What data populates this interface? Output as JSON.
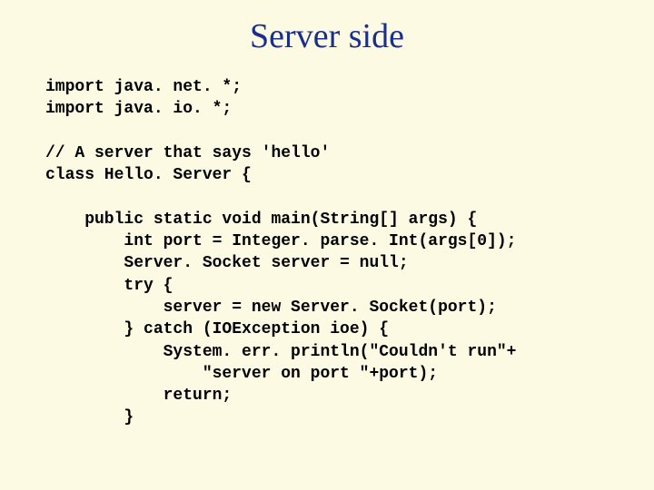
{
  "title": "Server side",
  "code": {
    "l01": "import java. net. *;",
    "l02": "import java. io. *;",
    "l03": "",
    "l04": "// A server that says 'hello'",
    "l05": "class Hello. Server {",
    "l06": "",
    "l07": "    public static void main(String[] args) {",
    "l08": "        int port = Integer. parse. Int(args[0]);",
    "l09": "        Server. Socket server = null;",
    "l10": "        try {",
    "l11": "            server = new Server. Socket(port);",
    "l12": "        } catch (IOException ioe) {",
    "l13": "            System. err. println(\"Couldn't run\"+",
    "l14": "                \"server on port \"+port);",
    "l15": "            return;",
    "l16": "        }"
  }
}
